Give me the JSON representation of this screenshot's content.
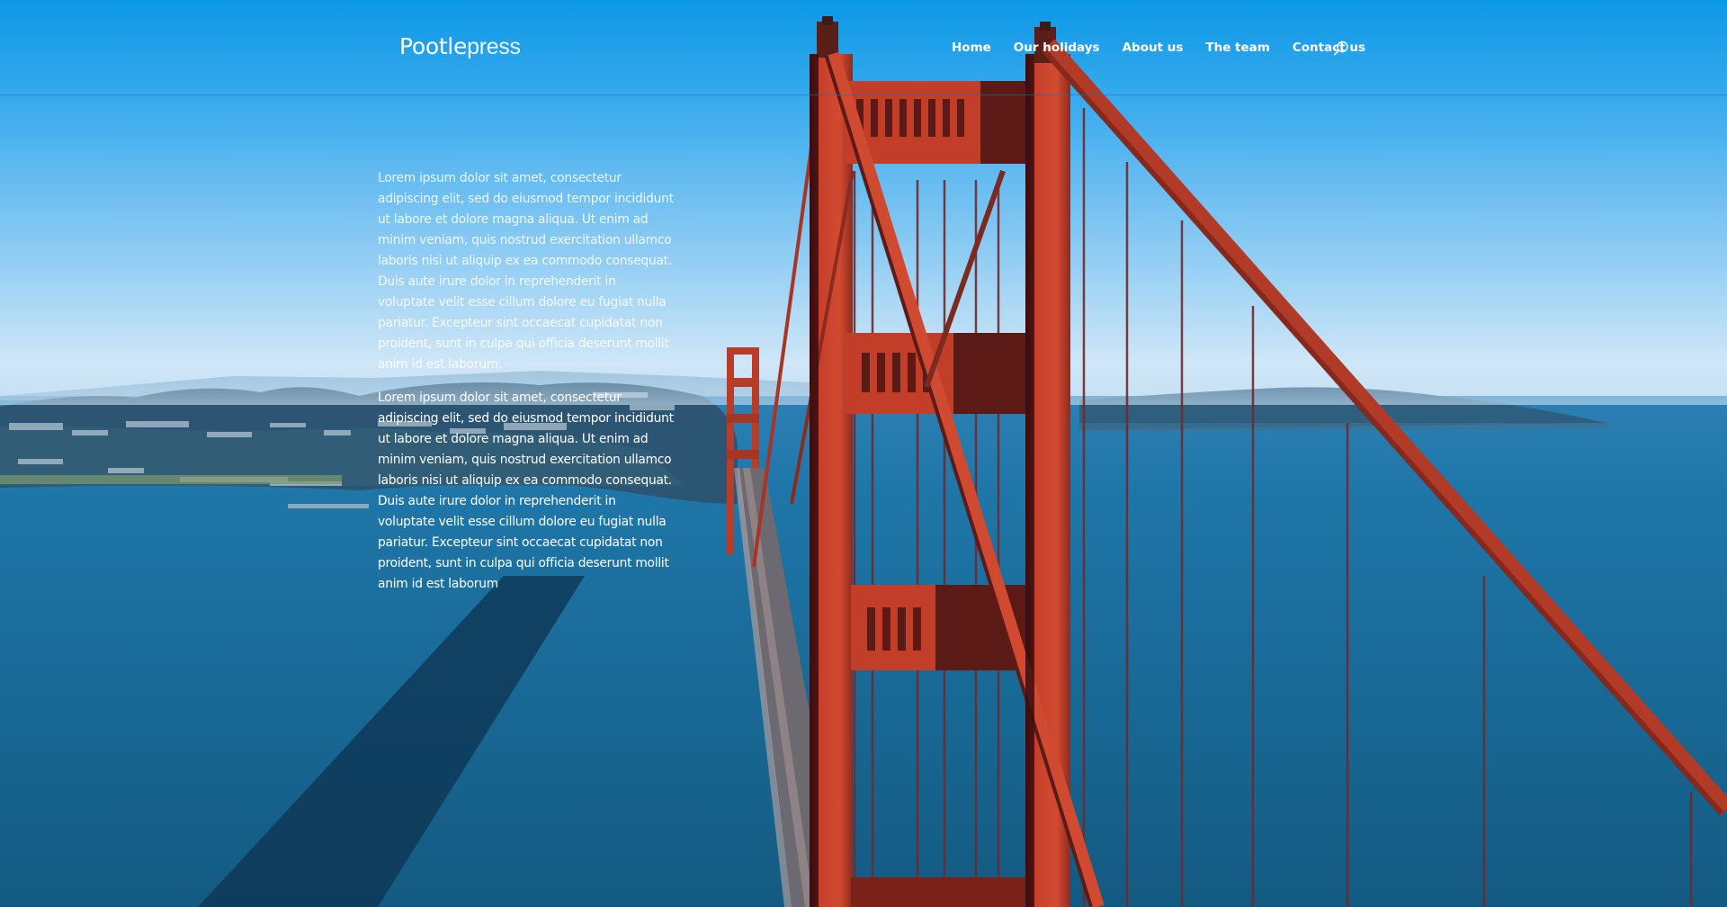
{
  "site": {
    "logo_bold": "Pootle",
    "logo_light": "press"
  },
  "nav": {
    "items": [
      {
        "label": "Home"
      },
      {
        "label": "Our holidays"
      },
      {
        "label": "About us"
      },
      {
        "label": "The team"
      },
      {
        "label": "Contact us"
      }
    ],
    "search_icon": "search-icon"
  },
  "content": {
    "paragraphs": [
      "Lorem ipsum dolor sit amet, consectetur adipiscing elit, sed do eiusmod tempor incididunt ut labore et dolore magna aliqua. Ut enim ad minim veniam, quis nostrud exercitation ullamco laboris nisi ut aliquip ex ea commodo consequat. Duis aute irure dolor in reprehenderit in voluptate velit esse cillum dolore eu fugiat nulla pariatur. Excepteur sint occaecat cupidatat non proident, sunt in culpa qui officia deserunt mollit anim id est laborum.",
      "Lorem ipsum dolor sit amet, consectetur adipiscing elit, sed do eiusmod tempor incididunt ut labore et dolore magna aliqua. Ut enim ad minim veniam, quis nostrud exercitation ullamco laboris nisi ut aliquip ex ea commodo consequat. Duis aute irure dolor in reprehenderit in voluptate velit esse cillum dolore eu fugiat nulla pariatur. Excepteur sint occaecat cupidatat non proident, sunt in culpa qui officia deserunt mollit anim id est laborum"
    ]
  },
  "background": {
    "description": "Aerial view of the Golden Gate Bridge over blue water",
    "colors": {
      "sky_top": "#0d9be8",
      "sky_horizon": "#cfe7f7",
      "water": "#1a6f9a",
      "bridge": "#c8402a",
      "bridge_shadow": "#5a1512"
    }
  }
}
